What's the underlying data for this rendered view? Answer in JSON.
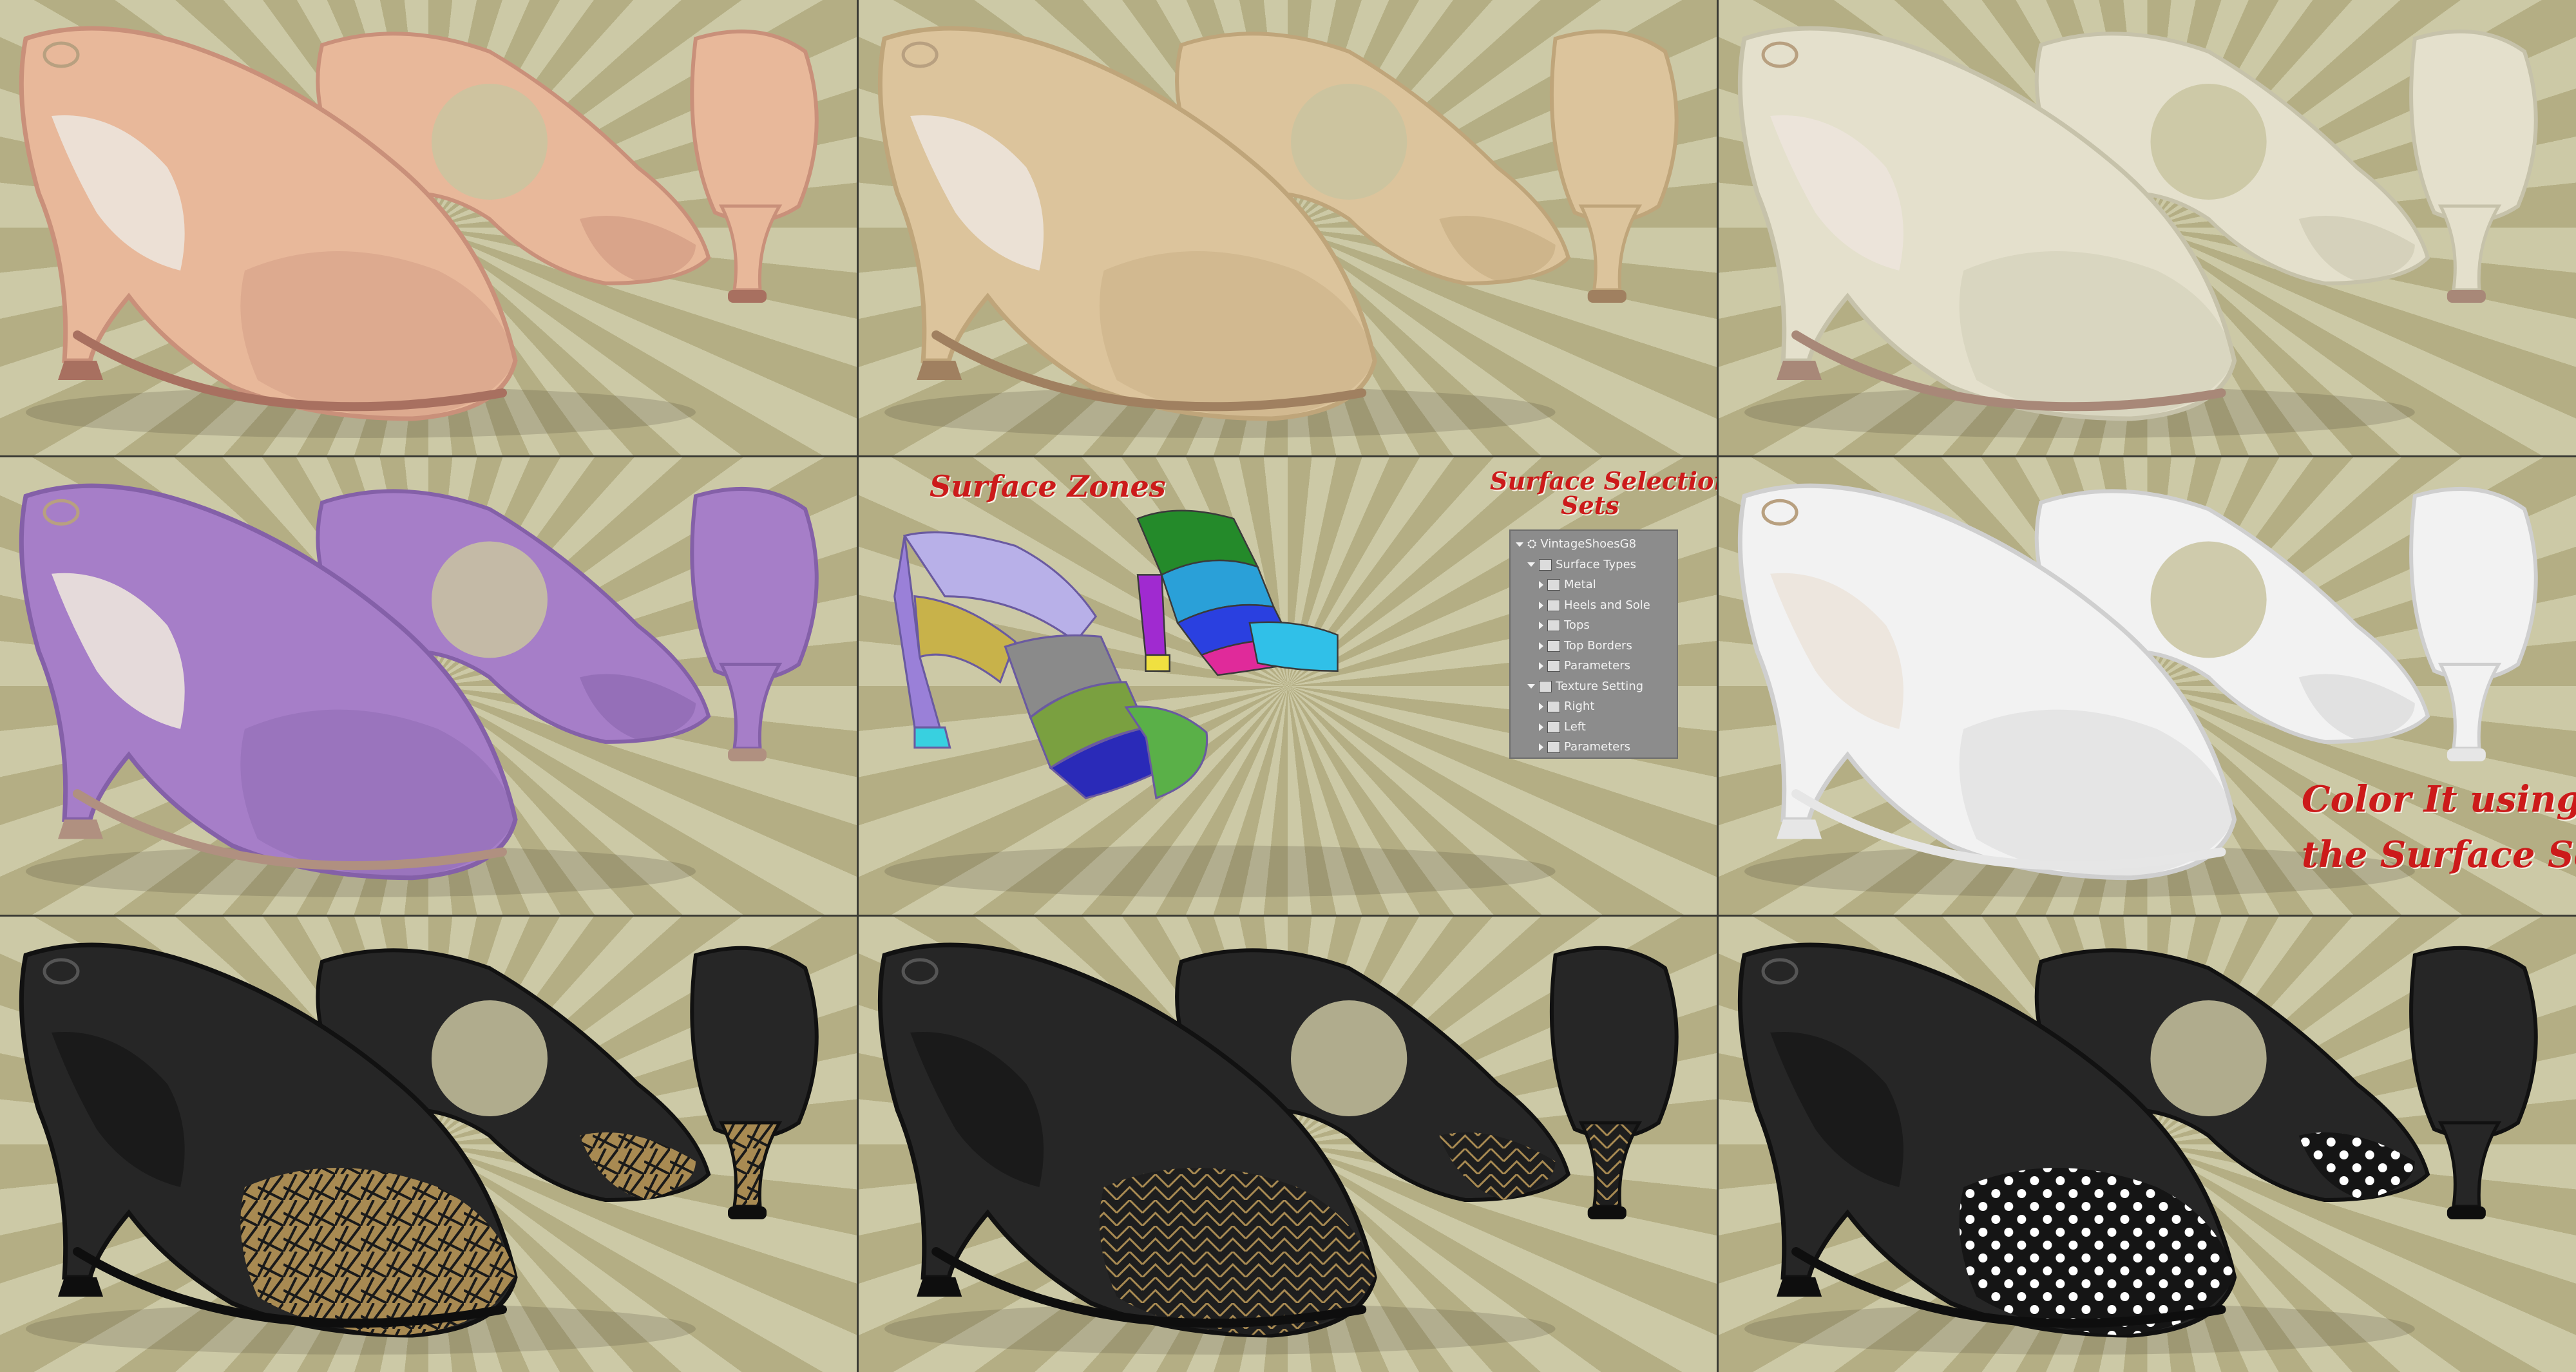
{
  "colors": {
    "nude": "#e8b89a",
    "gold": "#dcc49c",
    "champagne": "#e4e0cc",
    "lilac": "#a67ec8",
    "white": "#f2f2f2",
    "black": "#262626",
    "gold_pattern": "#a88a52",
    "title_red": "#cc1a1a"
  },
  "tiles": [
    {
      "variant": "Nude"
    },
    {
      "variant": "Gold"
    },
    {
      "variant": "Champagne"
    },
    {
      "variant": "Lilac"
    },
    {
      "variant": "Surface Zones"
    },
    {
      "variant": "White"
    },
    {
      "variant": "Black Art Deco Rays"
    },
    {
      "variant": "Black Art Deco Chevron"
    },
    {
      "variant": "Black Polka Dot"
    }
  ],
  "labels": {
    "surface_zones": "Surface Zones",
    "surface_selection_sets_1": "Surface Selection",
    "surface_selection_sets_2": "Sets",
    "color_it_1": "Color It using",
    "color_it_2": "the Surface Sets"
  },
  "tree": {
    "root": "VintageShoesG8",
    "items": [
      {
        "label": "Surface Types",
        "level": 1,
        "open": true
      },
      {
        "label": "Metal",
        "level": 2,
        "open": false
      },
      {
        "label": "Heels and Sole",
        "level": 2,
        "open": false
      },
      {
        "label": "Tops",
        "level": 2,
        "open": false
      },
      {
        "label": "Top Borders",
        "level": 2,
        "open": false
      },
      {
        "label": "Parameters",
        "level": 2,
        "open": false
      },
      {
        "label": "Texture Setting",
        "level": 1,
        "open": true
      },
      {
        "label": "Right",
        "level": 2,
        "open": false
      },
      {
        "label": "Left",
        "level": 2,
        "open": false
      },
      {
        "label": "Parameters",
        "level": 2,
        "open": false
      }
    ]
  }
}
